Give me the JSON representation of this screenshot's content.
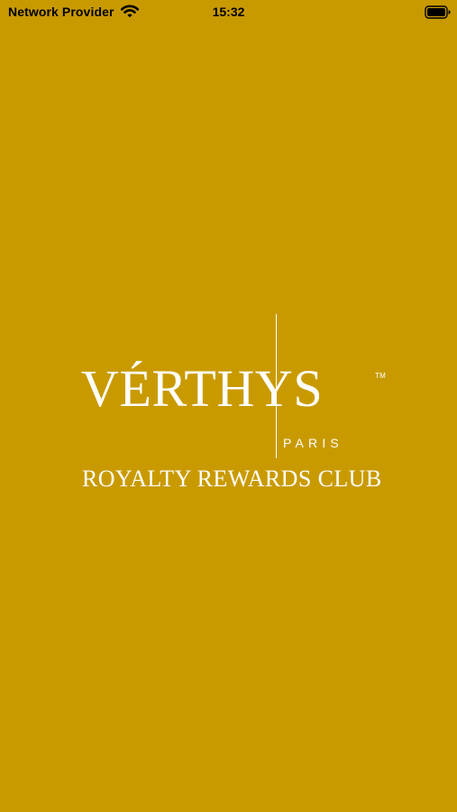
{
  "status_bar": {
    "carrier": "Network Provider",
    "time": "15:32",
    "wifi_icon": "wifi-icon",
    "battery_icon": "battery-icon",
    "battery_level": 1.0
  },
  "splash": {
    "brand": "VÉRTHYS",
    "trademark": "TM",
    "city": "PARIS",
    "tagline": "ROYALTY REWARDS CLUB"
  },
  "colors": {
    "background": "#C99A00",
    "logo": "#FFFFFF",
    "status_text": "#000000"
  }
}
